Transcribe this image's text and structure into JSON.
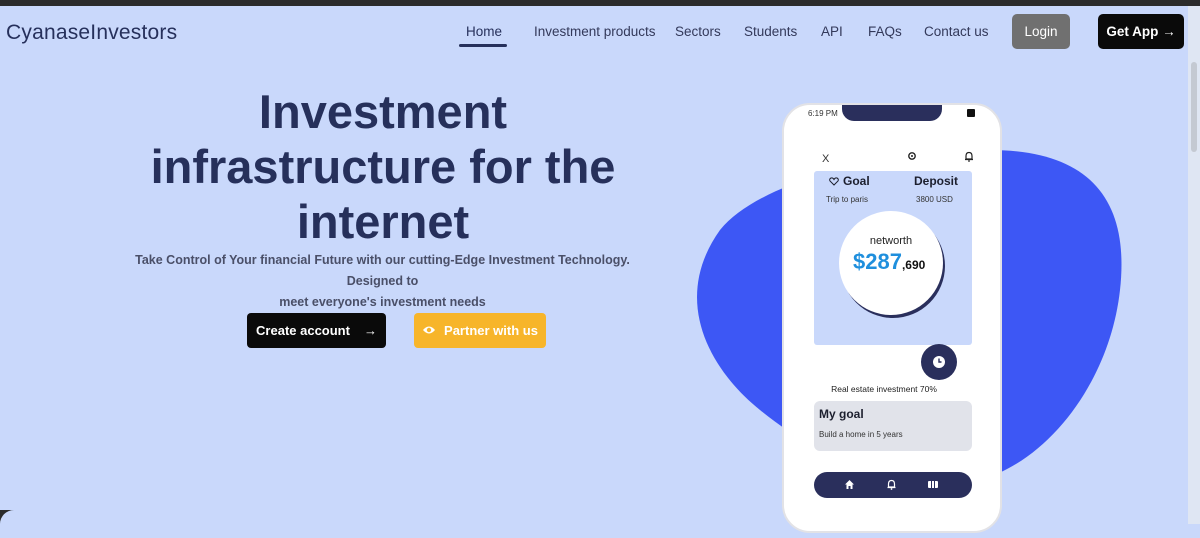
{
  "brand": "CyanaseInvestors",
  "nav": {
    "items": [
      {
        "label": "Home",
        "active": true
      },
      {
        "label": "Investment products"
      },
      {
        "label": "Sectors"
      },
      {
        "label": "Students"
      },
      {
        "label": "API"
      },
      {
        "label": "FAQs"
      },
      {
        "label": "Contact us"
      }
    ],
    "login_label": "Login",
    "getapp_label": "Get App →"
  },
  "hero": {
    "title_line1": "Investment",
    "title_line2": "infrastructure for the",
    "title_line3": "internet",
    "subtitle_line1": "Take Control of Your financial Future with our cutting-Edge Investment Technology. Designed to",
    "subtitle_line2": "meet everyone's investment needs",
    "create_label": "Create account",
    "create_arrow": "→",
    "partner_label": "Partner with us"
  },
  "phone": {
    "time": "6:19 PM",
    "close": "X",
    "goal_label": "Goal",
    "deposit_label": "Deposit",
    "goal_name": "Trip to paris",
    "deposit_amount": "3800 USD",
    "networth_label": "networth",
    "networth_value": "$287",
    "networth_cents": ",690",
    "real_estate": "Real estate investment 70%",
    "mygoal_title": "My goal",
    "mygoal_sub": "Build a home in 5 years"
  },
  "colors": {
    "background": "#c9d8fb",
    "primary_dark": "#26305b",
    "blob": "#3d57f5",
    "partner_button": "#f7b52a",
    "networth_blue": "#1f8fdd"
  }
}
